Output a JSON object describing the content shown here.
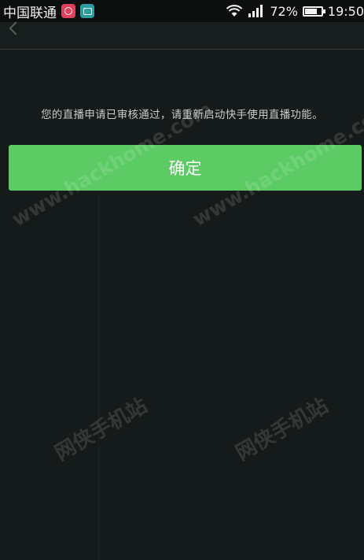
{
  "status_bar": {
    "carrier": "中国联通",
    "battery_percent": "72%",
    "time": "19:50",
    "icons": [
      "app-notification-icon",
      "camera-app-icon",
      "wifi-icon",
      "signal-icon",
      "battery-icon"
    ]
  },
  "dialog": {
    "message": "您的直播申请已审核通过，请重新启动快手使用直播功能。",
    "confirm_label": "确定"
  },
  "watermarks": {
    "url": "www.hackhome.com",
    "site_name": "网侠手机站"
  },
  "colors": {
    "button_green": "#5ccb64",
    "background": "#151b1a"
  }
}
